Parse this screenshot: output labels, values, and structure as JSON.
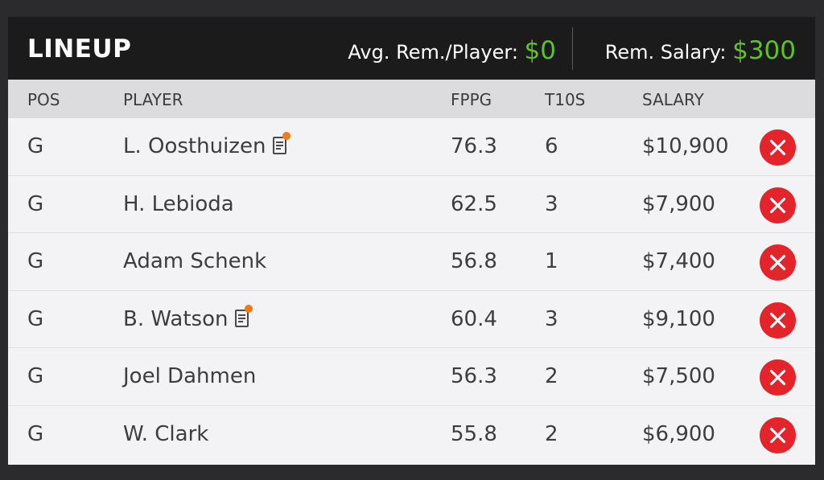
{
  "header": {
    "title": "LINEUP",
    "avg_label": "Avg. Rem./Player: ",
    "avg_value": "$0",
    "rem_label": "Rem. Salary: ",
    "rem_value": "$300"
  },
  "columns": {
    "pos": "POS",
    "player": "PLAYER",
    "fppg": "FPPG",
    "t10s": "T10S",
    "salary": "SALARY"
  },
  "players": [
    {
      "pos": "G",
      "name": "L. Oosthuizen",
      "news": true,
      "fppg": "76.3",
      "t10s": "6",
      "salary": "$10,900"
    },
    {
      "pos": "G",
      "name": "H. Lebioda",
      "news": false,
      "fppg": "62.5",
      "t10s": "3",
      "salary": "$7,900"
    },
    {
      "pos": "G",
      "name": "Adam Schenk",
      "news": false,
      "fppg": "56.8",
      "t10s": "1",
      "salary": "$7,400"
    },
    {
      "pos": "G",
      "name": "B. Watson",
      "news": true,
      "fppg": "60.4",
      "t10s": "3",
      "salary": "$9,100"
    },
    {
      "pos": "G",
      "name": "Joel Dahmen",
      "news": false,
      "fppg": "56.3",
      "t10s": "2",
      "salary": "$7,500"
    },
    {
      "pos": "G",
      "name": "W. Clark",
      "news": false,
      "fppg": "55.8",
      "t10s": "2",
      "salary": "$6,900"
    }
  ],
  "icons": {
    "news": "player-news-icon",
    "remove": "remove-player-icon"
  },
  "colors": {
    "accent_money": "#5fc22b",
    "remove_button": "#e3242b",
    "news_dot": "#f07a1a",
    "header_bg": "#1b1b1c"
  }
}
